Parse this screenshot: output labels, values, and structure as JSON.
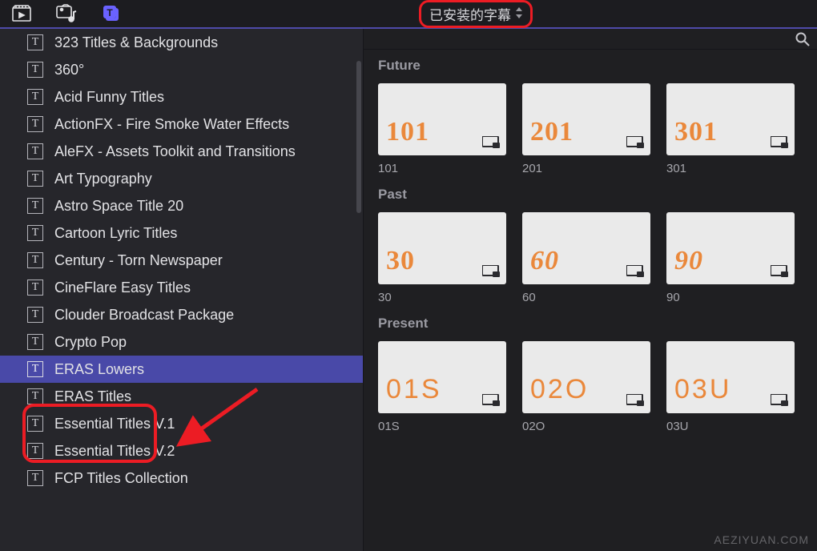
{
  "toolbar": {
    "dropdown_label": "已安装的字幕"
  },
  "sidebar": {
    "items": [
      {
        "label": "323 Titles & Backgrounds"
      },
      {
        "label": "360°"
      },
      {
        "label": "Acid Funny Titles"
      },
      {
        "label": "ActionFX - Fire Smoke Water Effects"
      },
      {
        "label": "AleFX - Assets Toolkit and Transitions"
      },
      {
        "label": "Art Typography"
      },
      {
        "label": "Astro Space Title 20"
      },
      {
        "label": "Cartoon Lyric Titles"
      },
      {
        "label": "Century - Torn Newspaper"
      },
      {
        "label": "CineFlare Easy Titles"
      },
      {
        "label": "Clouder Broadcast Package"
      },
      {
        "label": "Crypto Pop"
      },
      {
        "label": "ERAS Lowers"
      },
      {
        "label": "ERAS Titles"
      },
      {
        "label": "Essential Titles V.1"
      },
      {
        "label": "Essential Titles V.2"
      },
      {
        "label": "FCP Titles Collection"
      }
    ],
    "selected_index": 12
  },
  "content": {
    "sections": [
      {
        "title": "Future",
        "items": [
          {
            "preview": "101",
            "label": "101",
            "style": "slab"
          },
          {
            "preview": "201",
            "label": "201",
            "style": "slab"
          },
          {
            "preview": "301",
            "label": "301",
            "style": "slab"
          }
        ]
      },
      {
        "title": "Past",
        "items": [
          {
            "preview": "30",
            "label": "30",
            "style": "slab"
          },
          {
            "preview": "60",
            "label": "60",
            "style": "fat"
          },
          {
            "preview": "90",
            "label": "90",
            "style": "script"
          }
        ]
      },
      {
        "title": "Present",
        "items": [
          {
            "preview": "01S",
            "label": "01S",
            "style": "thin"
          },
          {
            "preview": "02O",
            "label": "02O",
            "style": "thin"
          },
          {
            "preview": "03U",
            "label": "03U",
            "style": "thin"
          }
        ]
      }
    ]
  },
  "watermark": "AEZIYUAN.COM",
  "icons": {
    "t": "T"
  }
}
